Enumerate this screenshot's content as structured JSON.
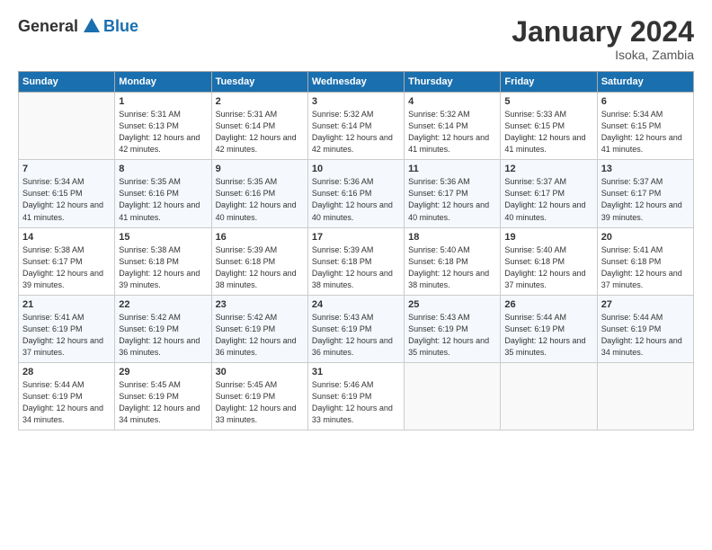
{
  "logo": {
    "general": "General",
    "blue": "Blue"
  },
  "header": {
    "title": "January 2024",
    "subtitle": "Isoka, Zambia"
  },
  "days_of_week": [
    "Sunday",
    "Monday",
    "Tuesday",
    "Wednesday",
    "Thursday",
    "Friday",
    "Saturday"
  ],
  "weeks": [
    [
      {
        "day": "",
        "sunrise": "",
        "sunset": "",
        "daylight": ""
      },
      {
        "day": "1",
        "sunrise": "Sunrise: 5:31 AM",
        "sunset": "Sunset: 6:13 PM",
        "daylight": "Daylight: 12 hours and 42 minutes."
      },
      {
        "day": "2",
        "sunrise": "Sunrise: 5:31 AM",
        "sunset": "Sunset: 6:14 PM",
        "daylight": "Daylight: 12 hours and 42 minutes."
      },
      {
        "day": "3",
        "sunrise": "Sunrise: 5:32 AM",
        "sunset": "Sunset: 6:14 PM",
        "daylight": "Daylight: 12 hours and 42 minutes."
      },
      {
        "day": "4",
        "sunrise": "Sunrise: 5:32 AM",
        "sunset": "Sunset: 6:14 PM",
        "daylight": "Daylight: 12 hours and 41 minutes."
      },
      {
        "day": "5",
        "sunrise": "Sunrise: 5:33 AM",
        "sunset": "Sunset: 6:15 PM",
        "daylight": "Daylight: 12 hours and 41 minutes."
      },
      {
        "day": "6",
        "sunrise": "Sunrise: 5:34 AM",
        "sunset": "Sunset: 6:15 PM",
        "daylight": "Daylight: 12 hours and 41 minutes."
      }
    ],
    [
      {
        "day": "7",
        "sunrise": "Sunrise: 5:34 AM",
        "sunset": "Sunset: 6:15 PM",
        "daylight": "Daylight: 12 hours and 41 minutes."
      },
      {
        "day": "8",
        "sunrise": "Sunrise: 5:35 AM",
        "sunset": "Sunset: 6:16 PM",
        "daylight": "Daylight: 12 hours and 41 minutes."
      },
      {
        "day": "9",
        "sunrise": "Sunrise: 5:35 AM",
        "sunset": "Sunset: 6:16 PM",
        "daylight": "Daylight: 12 hours and 40 minutes."
      },
      {
        "day": "10",
        "sunrise": "Sunrise: 5:36 AM",
        "sunset": "Sunset: 6:16 PM",
        "daylight": "Daylight: 12 hours and 40 minutes."
      },
      {
        "day": "11",
        "sunrise": "Sunrise: 5:36 AM",
        "sunset": "Sunset: 6:17 PM",
        "daylight": "Daylight: 12 hours and 40 minutes."
      },
      {
        "day": "12",
        "sunrise": "Sunrise: 5:37 AM",
        "sunset": "Sunset: 6:17 PM",
        "daylight": "Daylight: 12 hours and 40 minutes."
      },
      {
        "day": "13",
        "sunrise": "Sunrise: 5:37 AM",
        "sunset": "Sunset: 6:17 PM",
        "daylight": "Daylight: 12 hours and 39 minutes."
      }
    ],
    [
      {
        "day": "14",
        "sunrise": "Sunrise: 5:38 AM",
        "sunset": "Sunset: 6:17 PM",
        "daylight": "Daylight: 12 hours and 39 minutes."
      },
      {
        "day": "15",
        "sunrise": "Sunrise: 5:38 AM",
        "sunset": "Sunset: 6:18 PM",
        "daylight": "Daylight: 12 hours and 39 minutes."
      },
      {
        "day": "16",
        "sunrise": "Sunrise: 5:39 AM",
        "sunset": "Sunset: 6:18 PM",
        "daylight": "Daylight: 12 hours and 38 minutes."
      },
      {
        "day": "17",
        "sunrise": "Sunrise: 5:39 AM",
        "sunset": "Sunset: 6:18 PM",
        "daylight": "Daylight: 12 hours and 38 minutes."
      },
      {
        "day": "18",
        "sunrise": "Sunrise: 5:40 AM",
        "sunset": "Sunset: 6:18 PM",
        "daylight": "Daylight: 12 hours and 38 minutes."
      },
      {
        "day": "19",
        "sunrise": "Sunrise: 5:40 AM",
        "sunset": "Sunset: 6:18 PM",
        "daylight": "Daylight: 12 hours and 37 minutes."
      },
      {
        "day": "20",
        "sunrise": "Sunrise: 5:41 AM",
        "sunset": "Sunset: 6:18 PM",
        "daylight": "Daylight: 12 hours and 37 minutes."
      }
    ],
    [
      {
        "day": "21",
        "sunrise": "Sunrise: 5:41 AM",
        "sunset": "Sunset: 6:19 PM",
        "daylight": "Daylight: 12 hours and 37 minutes."
      },
      {
        "day": "22",
        "sunrise": "Sunrise: 5:42 AM",
        "sunset": "Sunset: 6:19 PM",
        "daylight": "Daylight: 12 hours and 36 minutes."
      },
      {
        "day": "23",
        "sunrise": "Sunrise: 5:42 AM",
        "sunset": "Sunset: 6:19 PM",
        "daylight": "Daylight: 12 hours and 36 minutes."
      },
      {
        "day": "24",
        "sunrise": "Sunrise: 5:43 AM",
        "sunset": "Sunset: 6:19 PM",
        "daylight": "Daylight: 12 hours and 36 minutes."
      },
      {
        "day": "25",
        "sunrise": "Sunrise: 5:43 AM",
        "sunset": "Sunset: 6:19 PM",
        "daylight": "Daylight: 12 hours and 35 minutes."
      },
      {
        "day": "26",
        "sunrise": "Sunrise: 5:44 AM",
        "sunset": "Sunset: 6:19 PM",
        "daylight": "Daylight: 12 hours and 35 minutes."
      },
      {
        "day": "27",
        "sunrise": "Sunrise: 5:44 AM",
        "sunset": "Sunset: 6:19 PM",
        "daylight": "Daylight: 12 hours and 34 minutes."
      }
    ],
    [
      {
        "day": "28",
        "sunrise": "Sunrise: 5:44 AM",
        "sunset": "Sunset: 6:19 PM",
        "daylight": "Daylight: 12 hours and 34 minutes."
      },
      {
        "day": "29",
        "sunrise": "Sunrise: 5:45 AM",
        "sunset": "Sunset: 6:19 PM",
        "daylight": "Daylight: 12 hours and 34 minutes."
      },
      {
        "day": "30",
        "sunrise": "Sunrise: 5:45 AM",
        "sunset": "Sunset: 6:19 PM",
        "daylight": "Daylight: 12 hours and 33 minutes."
      },
      {
        "day": "31",
        "sunrise": "Sunrise: 5:46 AM",
        "sunset": "Sunset: 6:19 PM",
        "daylight": "Daylight: 12 hours and 33 minutes."
      },
      {
        "day": "",
        "sunrise": "",
        "sunset": "",
        "daylight": ""
      },
      {
        "day": "",
        "sunrise": "",
        "sunset": "",
        "daylight": ""
      },
      {
        "day": "",
        "sunrise": "",
        "sunset": "",
        "daylight": ""
      }
    ]
  ]
}
